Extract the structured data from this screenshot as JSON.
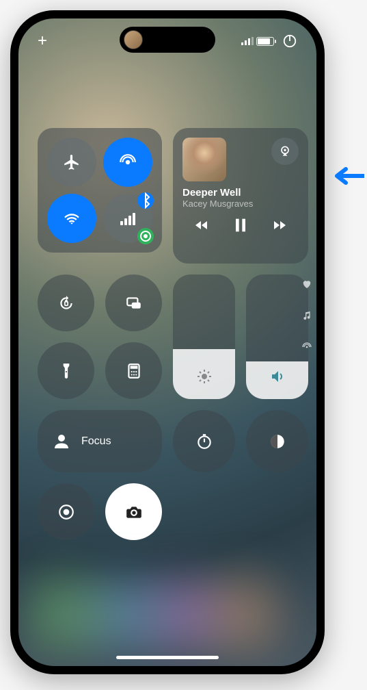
{
  "status_bar": {
    "add_control_label": "+",
    "battery_percent": 75
  },
  "connectivity": {
    "airplane": {
      "active": false,
      "name": "Airplane Mode"
    },
    "airdrop": {
      "active": true,
      "name": "AirDrop"
    },
    "wifi": {
      "active": true,
      "name": "Wi-Fi"
    },
    "cellular": {
      "active": false,
      "name": "Cellular Data",
      "bluetooth_sub": true,
      "personal_hotspot_sub": true
    }
  },
  "media": {
    "track_title": "Deeper Well",
    "track_artist": "Kacey Musgraves",
    "state": "paused",
    "airplay_available": true
  },
  "controls": {
    "orientation_lock": {
      "name": "Orientation Lock"
    },
    "screen_mirroring": {
      "name": "Screen Mirroring"
    },
    "flashlight": {
      "name": "Flashlight"
    },
    "calculator": {
      "name": "Calculator"
    },
    "focus": {
      "label": "Focus"
    },
    "timer": {
      "name": "Timer"
    },
    "dark_mode": {
      "name": "Dark Mode"
    },
    "screen_record": {
      "name": "Screen Record"
    },
    "camera": {
      "name": "Camera"
    }
  },
  "sliders": {
    "brightness": {
      "value_percent": 40
    },
    "volume": {
      "value_percent": 30
    }
  },
  "page_indicators": {
    "items": [
      "favorites",
      "music",
      "connectivity"
    ]
  }
}
